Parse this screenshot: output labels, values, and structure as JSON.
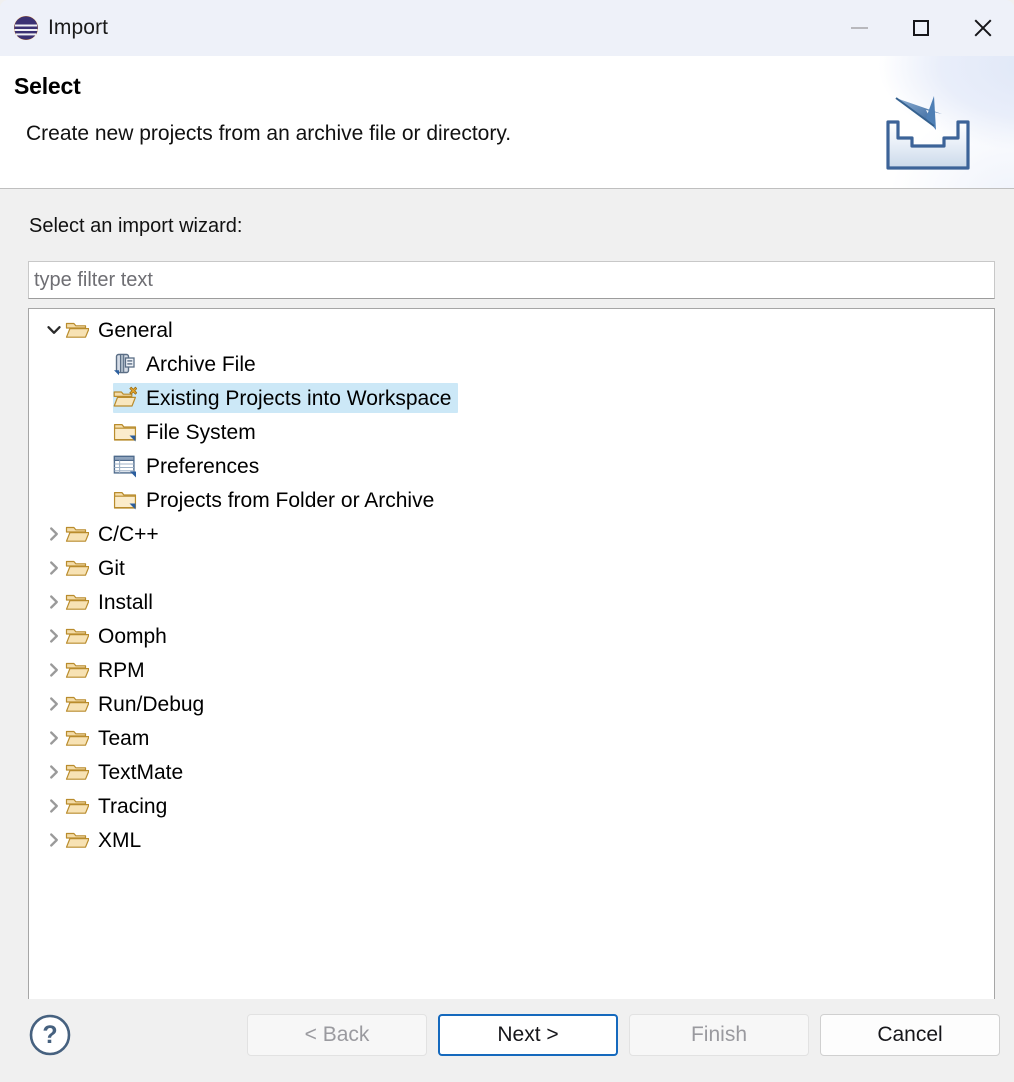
{
  "window": {
    "title": "Import",
    "logo_icon": "eclipse-logo",
    "controls": {
      "minimize": "minimize-icon",
      "maximize": "maximize-icon",
      "close": "close-icon"
    }
  },
  "header": {
    "title": "Select",
    "description": "Create new projects from an archive file or directory.",
    "banner_icon": "import-banner-icon"
  },
  "main": {
    "field_label": "Select an import wizard:",
    "filter": {
      "placeholder": "type filter text",
      "value": ""
    },
    "tree": [
      {
        "label": "General",
        "icon": "folder-open-icon",
        "level": 0,
        "expanded": true,
        "twisty": "chevron-down-icon",
        "selected": false
      },
      {
        "label": "Archive File",
        "icon": "archive-file-icon",
        "level": 1,
        "expanded": false,
        "twisty": "",
        "selected": false
      },
      {
        "label": "Existing Projects into Workspace",
        "icon": "import-projects-icon",
        "level": 1,
        "expanded": false,
        "twisty": "",
        "selected": true
      },
      {
        "label": "File System",
        "icon": "folder-closed-icon",
        "level": 1,
        "expanded": false,
        "twisty": "",
        "selected": false
      },
      {
        "label": "Preferences",
        "icon": "preferences-table-icon",
        "level": 1,
        "expanded": false,
        "twisty": "",
        "selected": false
      },
      {
        "label": "Projects from Folder or Archive",
        "icon": "folder-closed-icon",
        "level": 1,
        "expanded": false,
        "twisty": "",
        "selected": false
      },
      {
        "label": "C/C++",
        "icon": "folder-open-icon",
        "level": 0,
        "expanded": false,
        "twisty": "chevron-right-icon",
        "selected": false
      },
      {
        "label": "Git",
        "icon": "folder-open-icon",
        "level": 0,
        "expanded": false,
        "twisty": "chevron-right-icon",
        "selected": false
      },
      {
        "label": "Install",
        "icon": "folder-open-icon",
        "level": 0,
        "expanded": false,
        "twisty": "chevron-right-icon",
        "selected": false
      },
      {
        "label": "Oomph",
        "icon": "folder-open-icon",
        "level": 0,
        "expanded": false,
        "twisty": "chevron-right-icon",
        "selected": false
      },
      {
        "label": "RPM",
        "icon": "folder-open-icon",
        "level": 0,
        "expanded": false,
        "twisty": "chevron-right-icon",
        "selected": false
      },
      {
        "label": "Run/Debug",
        "icon": "folder-open-icon",
        "level": 0,
        "expanded": false,
        "twisty": "chevron-right-icon",
        "selected": false
      },
      {
        "label": "Team",
        "icon": "folder-open-icon",
        "level": 0,
        "expanded": false,
        "twisty": "chevron-right-icon",
        "selected": false
      },
      {
        "label": "TextMate",
        "icon": "folder-open-icon",
        "level": 0,
        "expanded": false,
        "twisty": "chevron-right-icon",
        "selected": false
      },
      {
        "label": "Tracing",
        "icon": "folder-open-icon",
        "level": 0,
        "expanded": false,
        "twisty": "chevron-right-icon",
        "selected": false
      },
      {
        "label": "XML",
        "icon": "folder-open-icon",
        "level": 0,
        "expanded": false,
        "twisty": "chevron-right-icon",
        "selected": false
      }
    ]
  },
  "footer": {
    "help_icon": "help-question-icon",
    "buttons": [
      {
        "label": "< Back",
        "state": "disabled"
      },
      {
        "label": "Next >",
        "state": "default"
      },
      {
        "label": "Finish",
        "state": "disabled"
      },
      {
        "label": "Cancel",
        "state": "enabled"
      }
    ]
  },
  "colors": {
    "titlebar_bg": "#eef1f9",
    "body_bg": "#f0f0f0",
    "selection_bg": "#cce8f7",
    "default_button_border": "#1569bd",
    "folder_gold": "#e8b860",
    "eclipse_orange": "#f4901e",
    "eclipse_purple": "#3b3173"
  }
}
